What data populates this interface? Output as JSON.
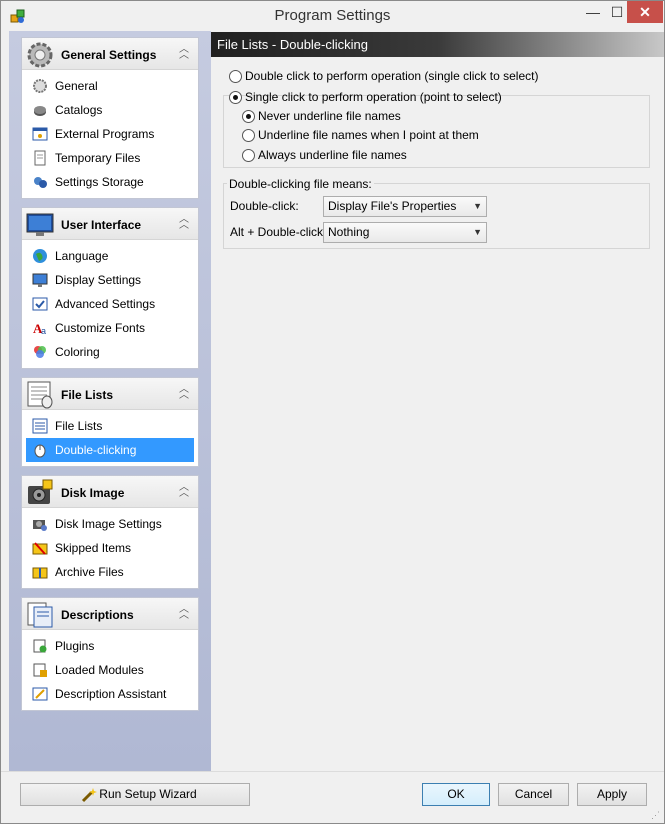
{
  "window": {
    "title": "Program Settings",
    "close_glyph": "✕",
    "min_glyph": "—",
    "max_glyph": "☐"
  },
  "sidebar": {
    "groups": [
      {
        "title": "General Settings",
        "icon": "gear-icon",
        "items": [
          {
            "label": "General",
            "icon": "gear-small-icon"
          },
          {
            "label": "Catalogs",
            "icon": "catalog-icon"
          },
          {
            "label": "External Programs",
            "icon": "external-programs-icon"
          },
          {
            "label": "Temporary Files",
            "icon": "temp-files-icon"
          },
          {
            "label": "Settings Storage",
            "icon": "settings-storage-icon"
          }
        ]
      },
      {
        "title": "User Interface",
        "icon": "monitor-icon",
        "items": [
          {
            "label": "Language",
            "icon": "globe-icon"
          },
          {
            "label": "Display Settings",
            "icon": "display-icon"
          },
          {
            "label": "Advanced Settings",
            "icon": "advanced-settings-icon"
          },
          {
            "label": "Customize Fonts",
            "icon": "fonts-icon"
          },
          {
            "label": "Coloring",
            "icon": "palette-icon"
          }
        ]
      },
      {
        "title": "File Lists",
        "icon": "file-list-icon",
        "items": [
          {
            "label": "File Lists",
            "icon": "file-list-small-icon"
          },
          {
            "label": "Double-clicking",
            "icon": "mouse-icon",
            "selected": true
          }
        ]
      },
      {
        "title": "Disk Image",
        "icon": "disk-image-icon",
        "items": [
          {
            "label": "Disk Image Settings",
            "icon": "disk-settings-icon"
          },
          {
            "label": "Skipped Items",
            "icon": "skipped-items-icon"
          },
          {
            "label": "Archive Files",
            "icon": "archive-icon"
          }
        ]
      },
      {
        "title": "Descriptions",
        "icon": "descriptions-icon",
        "items": [
          {
            "label": "Plugins",
            "icon": "plugin-icon"
          },
          {
            "label": "Loaded Modules",
            "icon": "modules-icon"
          },
          {
            "label": "Description Assistant",
            "icon": "assistant-icon"
          }
        ]
      }
    ]
  },
  "panel": {
    "header": "File Lists - Double-clicking",
    "click_mode": {
      "option_double": "Double click to perform operation (single click to select)",
      "option_single": "Single click to perform operation (point to select)",
      "selected": "single",
      "underline": {
        "never": "Never underline file names",
        "when_point": "Underline file names when I point at them",
        "always": "Always underline file names",
        "selected": "never"
      }
    },
    "meaning": {
      "legend": "Double-clicking file means:",
      "double_click_label": "Double-click:",
      "double_click_value": "Display File's Properties",
      "alt_double_click_label": "Alt + Double-click:",
      "alt_double_click_value": "Nothing"
    }
  },
  "footer": {
    "wizard_label": "Run Setup Wizard",
    "ok_label": "OK",
    "cancel_label": "Cancel",
    "apply_label": "Apply"
  },
  "colors": {
    "selected": "#3399ff",
    "close": "#c7504a",
    "sidebar_bg": "#b9c0d9"
  }
}
